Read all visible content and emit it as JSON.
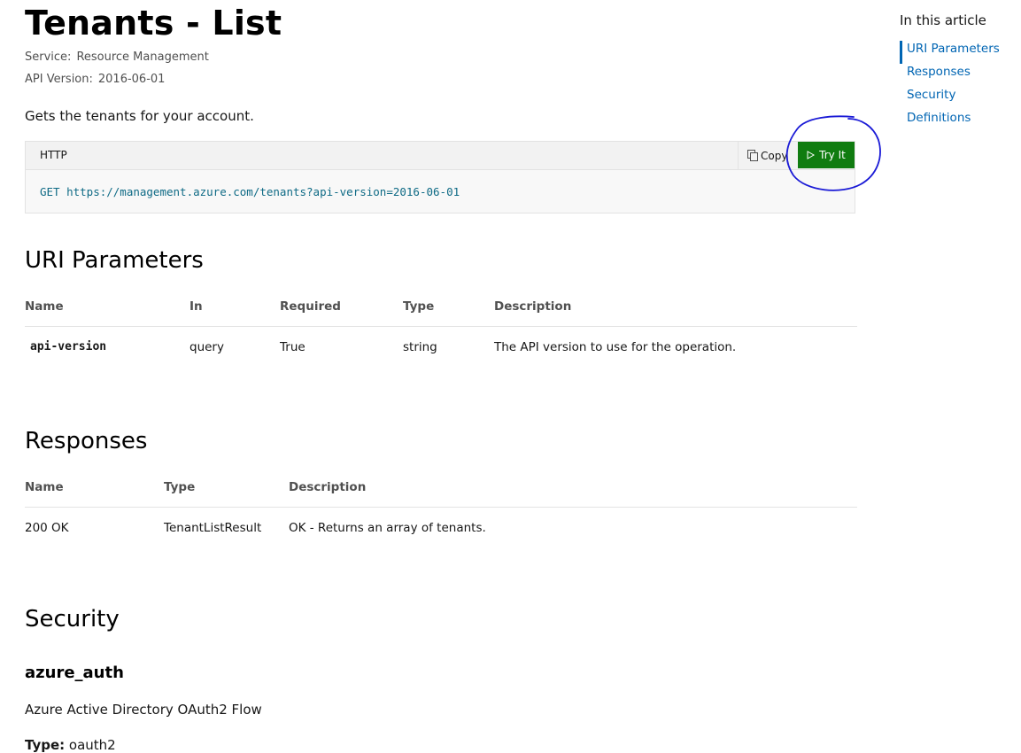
{
  "page": {
    "title": "Tenants - List",
    "service_label": "Service:",
    "service_value": "Resource Management",
    "api_version_label": "API Version:",
    "api_version_value": "2016-06-01",
    "description": "Gets the tenants for your account."
  },
  "code_block": {
    "language": "HTTP",
    "copy_label": "Copy",
    "try_label": "Try It",
    "code": "GET https://management.azure.com/tenants?api-version=2016-06-01"
  },
  "uri_parameters": {
    "heading": "URI Parameters",
    "columns": [
      "Name",
      "In",
      "Required",
      "Type",
      "Description"
    ],
    "rows": [
      [
        "api-version",
        "query",
        "True",
        "string",
        "The API version to use for the operation."
      ]
    ]
  },
  "responses": {
    "heading": "Responses",
    "columns": [
      "Name",
      "Type",
      "Description"
    ],
    "rows": [
      [
        "200 OK",
        "TenantListResult",
        "OK - Returns an array of tenants."
      ]
    ]
  },
  "security": {
    "heading": "Security",
    "scheme_name": "azure_auth",
    "scheme_description": "Azure Active Directory OAuth2 Flow",
    "type_label": "Type:",
    "type_value": "oauth2"
  },
  "in_this_article": {
    "heading": "In this article",
    "items": [
      "URI Parameters",
      "Responses",
      "Security",
      "Definitions"
    ]
  },
  "colors": {
    "accent_link": "#0065b3",
    "try_button": "#107c10",
    "annotation": "#1a1ad6"
  },
  "icons": {
    "copy": "copy-icon",
    "play": "play-icon"
  }
}
